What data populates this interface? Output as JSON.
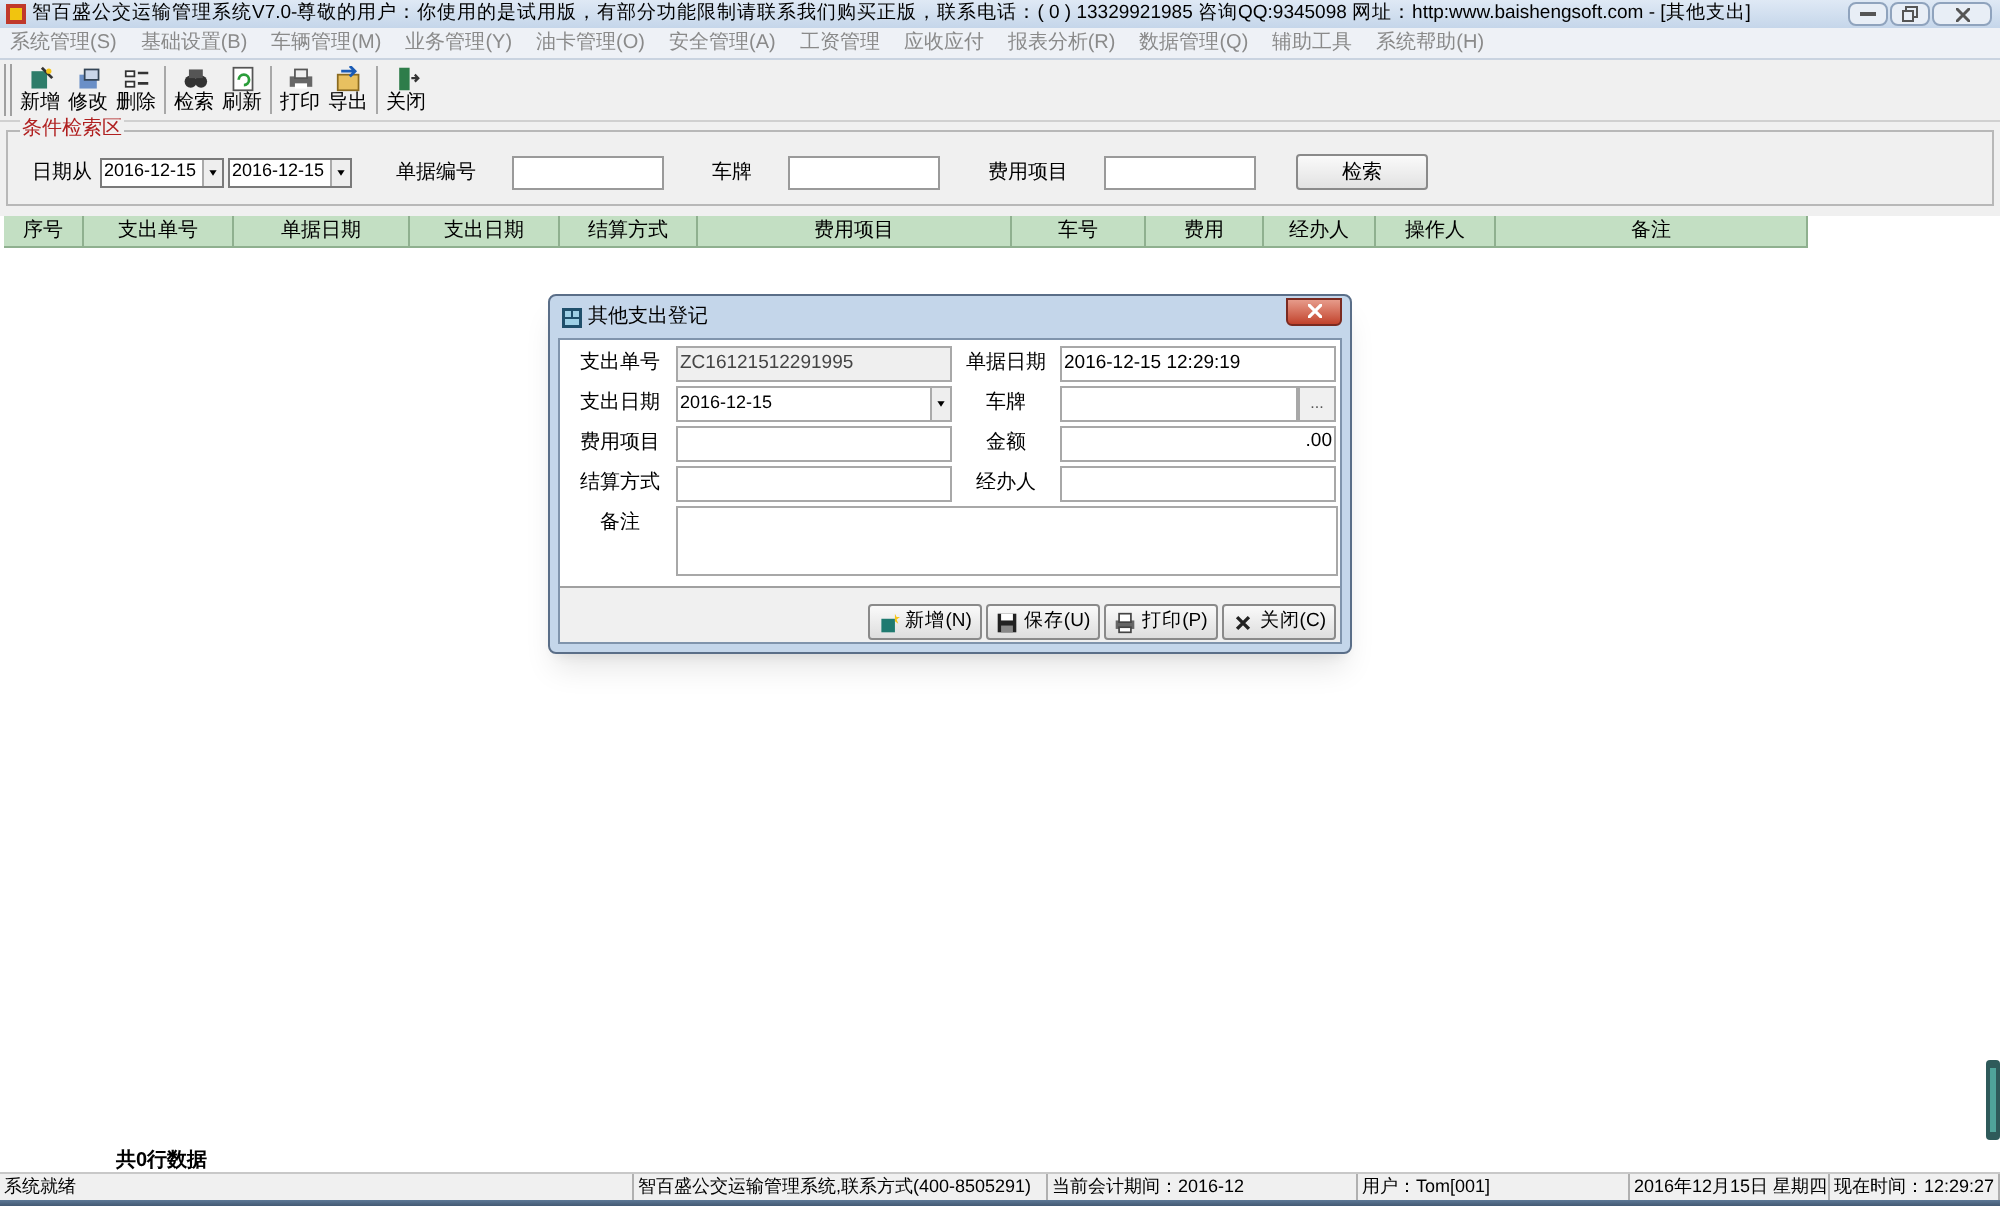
{
  "window": {
    "title": "智百盛公交运输管理系统V7.0-尊敬的用户：你使用的是试用版，有部分功能限制请联系我们购买正版，联系电话：( 0 ) 13329921985 咨询QQ:9345098 网址：http:www.baishengsoft.com - [其他支出]"
  },
  "menu": [
    {
      "label": "系统管理(S)"
    },
    {
      "label": "基础设置(B)"
    },
    {
      "label": "车辆管理(M)"
    },
    {
      "label": "业务管理(Y)"
    },
    {
      "label": "油卡管理(O)"
    },
    {
      "label": "安全管理(A)"
    },
    {
      "label": "工资管理"
    },
    {
      "label": "应收应付"
    },
    {
      "label": "报表分析(R)"
    },
    {
      "label": "数据管理(Q)"
    },
    {
      "label": "辅助工具"
    },
    {
      "label": "系统帮助(H)"
    }
  ],
  "toolbar": [
    {
      "label": "新增",
      "kind": "new"
    },
    {
      "label": "修改",
      "kind": "edit"
    },
    {
      "label": "删除",
      "kind": "delete",
      "group_end": true
    },
    {
      "label": "检索",
      "kind": "search"
    },
    {
      "label": "刷新",
      "kind": "refresh",
      "group_end": true
    },
    {
      "label": "打印",
      "kind": "print"
    },
    {
      "label": "导出",
      "kind": "export",
      "group_end": true
    },
    {
      "label": "关闭",
      "kind": "close"
    }
  ],
  "search_area": {
    "title": "条件检索区",
    "date_label": "日期从",
    "date_from": "2016-12-15",
    "date_to": "2016-12-15",
    "fields": [
      {
        "label": "单据编号"
      },
      {
        "label": "车牌"
      },
      {
        "label": "费用项目"
      }
    ],
    "button": "检索"
  },
  "table": {
    "columns": [
      "序号",
      "支出单号",
      "单据日期",
      "支出日期",
      "结算方式",
      "费用项目",
      "车号",
      "费用",
      "经办人",
      "操作人",
      "备注"
    ],
    "footer": "共0行数据"
  },
  "dialog": {
    "title": "其他支出登记",
    "fields": [
      {
        "label": "支出单号",
        "kind": "readonly",
        "value": "ZC16121512291995"
      },
      {
        "label": "单据日期",
        "kind": "text",
        "value": "2016-12-15 12:29:19"
      },
      {
        "label": "支出日期",
        "kind": "dropdown",
        "value": "2016-12-15"
      },
      {
        "label": "车牌",
        "kind": "lookup",
        "button": "..."
      },
      {
        "label": "费用项目",
        "kind": "text"
      },
      {
        "label": "金额",
        "kind": "number",
        "value": ".00"
      },
      {
        "label": "结算方式",
        "kind": "text"
      },
      {
        "label": "经办人",
        "kind": "text"
      },
      {
        "label": "备注",
        "kind": "memo"
      }
    ],
    "buttons": [
      {
        "label": "新增(N)",
        "kind": "new"
      },
      {
        "label": "保存(U)",
        "kind": "save"
      },
      {
        "label": "打印(P)",
        "kind": "print"
      },
      {
        "label": "关闭(C)",
        "kind": "close"
      }
    ]
  },
  "status_bar": [
    "系统就绪",
    "智百盛公交运输管理系统,联系方式(400-8505291)",
    "当前会计期间：2016-12",
    "用户：Tom[001]",
    "2016年12月15日 星期四",
    "现在时间：12:29:27"
  ]
}
